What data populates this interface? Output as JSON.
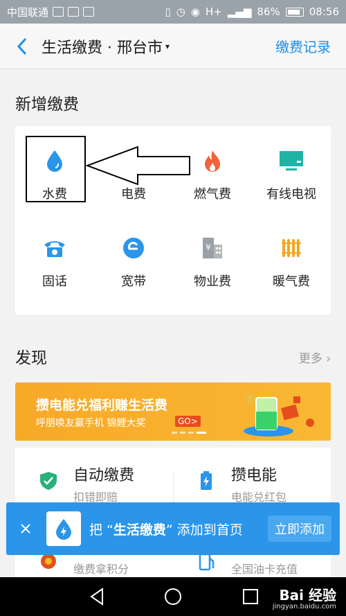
{
  "status_bar": {
    "carrier": "中国联通",
    "signal": "H+",
    "battery": "86%",
    "time": "08:56"
  },
  "header": {
    "title": "生活缴费 · 邢台市",
    "caret": "▾",
    "records_label": "缴费记录"
  },
  "new_payment": {
    "heading": "新增缴费",
    "items": [
      {
        "label": "水费",
        "icon": "water-drop-icon",
        "color": "#2a95e9"
      },
      {
        "label": "电费",
        "icon": "lightning-icon",
        "color": "#f5b721"
      },
      {
        "label": "燃气费",
        "icon": "flame-icon",
        "color": "#f1643a"
      },
      {
        "label": "有线电视",
        "icon": "tv-icon",
        "color": "#1fb3a6"
      },
      {
        "label": "固话",
        "icon": "telephone-icon",
        "color": "#2a95e9"
      },
      {
        "label": "宽带",
        "icon": "broadband-icon",
        "color": "#2a95e9"
      },
      {
        "label": "物业费",
        "icon": "building-icon",
        "color": "#9aa0a6"
      },
      {
        "label": "暖气费",
        "icon": "radiator-icon",
        "color": "#f5a623"
      }
    ]
  },
  "discover": {
    "heading": "发现",
    "more_label": "更多",
    "banner": {
      "title": "攒电能兑福利赚生活费",
      "subtitle": "呼朋唤友赢手机 锦鲤大奖",
      "go_label": "GO>"
    },
    "services": [
      {
        "title": "自动缴费",
        "subtitle": "扣错即赔",
        "icon": "shield-check-icon"
      },
      {
        "title": "攒电能",
        "subtitle": "电能兑红包",
        "icon": "battery-icon"
      },
      {
        "title": "",
        "subtitle": "缴费拿积分",
        "icon": "points-icon"
      },
      {
        "title": "",
        "subtitle": "全国油卡充值",
        "icon": "fuel-icon"
      }
    ]
  },
  "add_bar": {
    "prefix": "把 “",
    "app_name": "生活缴费",
    "suffix": "” 添加到首页",
    "button_label": "立即添加"
  },
  "watermark": {
    "brand": "Bai 经验",
    "url": "jingyan.baidu.com"
  },
  "colors": {
    "accent": "#2a95e9",
    "banner": "#f7a928"
  }
}
